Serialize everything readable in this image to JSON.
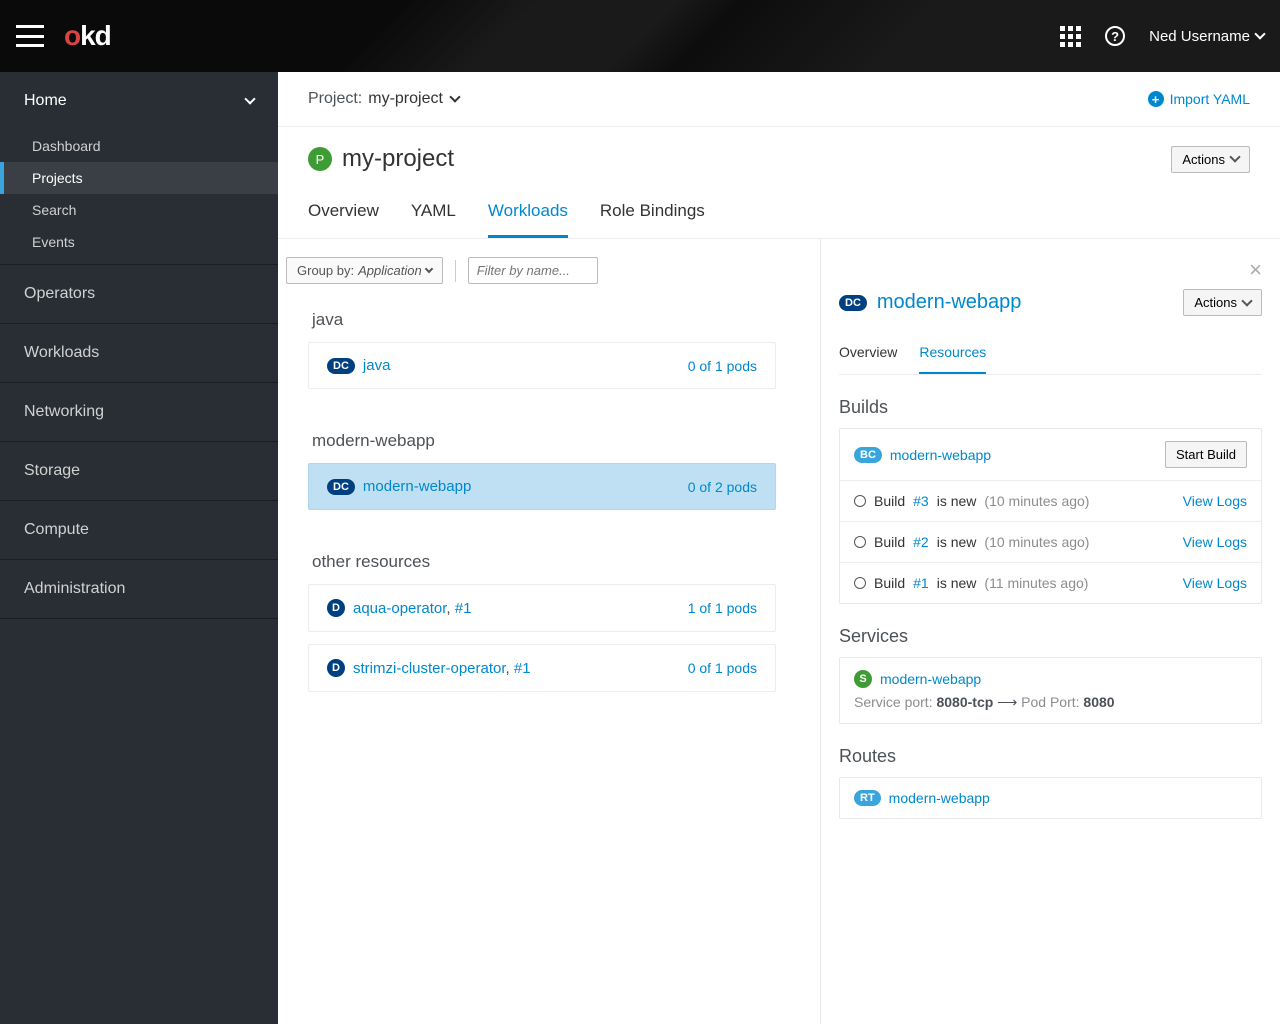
{
  "topbar": {
    "username": "Ned Username"
  },
  "sidebar": {
    "home": "Home",
    "items": [
      "Dashboard",
      "Projects",
      "Search",
      "Events"
    ],
    "sections": [
      "Operators",
      "Workloads",
      "Networking",
      "Storage",
      "Compute",
      "Administration"
    ]
  },
  "projectbar": {
    "label": "Project:",
    "name": "my-project",
    "import": "Import YAML"
  },
  "page": {
    "title": "my-project",
    "actions": "Actions"
  },
  "tabs": [
    "Overview",
    "YAML",
    "Workloads",
    "Role Bindings"
  ],
  "filters": {
    "groupby_label": "Group by:",
    "groupby_value": "Application",
    "filter_placeholder": "Filter by name..."
  },
  "groups": [
    {
      "name": "java",
      "items": [
        {
          "badge": "DC",
          "name": "java",
          "meta": "0 of 1 pods",
          "selected": false
        }
      ]
    },
    {
      "name": "modern-webapp",
      "items": [
        {
          "badge": "DC",
          "name": "modern-webapp",
          "meta": "0 of 2 pods",
          "selected": true
        }
      ]
    },
    {
      "name": "other resources",
      "items": [
        {
          "badge": "D",
          "name": "aqua-operator",
          "deploy": "#1",
          "meta": "1 of 1 pods"
        },
        {
          "badge": "D",
          "name": "strimzi-cluster-operator",
          "deploy": "#1",
          "meta": "0 of 1 pods"
        }
      ]
    }
  ],
  "detail": {
    "badge": "DC",
    "title": "modern-webapp",
    "actions": "Actions",
    "tabs": [
      "Overview",
      "Resources"
    ],
    "builds": {
      "title": "Builds",
      "bc_name": "modern-webapp",
      "start_build": "Start Build",
      "list": [
        {
          "num": "#3",
          "status": "is new",
          "time": "(10 minutes ago)",
          "view": "View Logs"
        },
        {
          "num": "#2",
          "status": "is new",
          "time": "(10 minutes ago)",
          "view": "View Logs"
        },
        {
          "num": "#1",
          "status": "is new",
          "time": "(11 minutes ago)",
          "view": "View Logs"
        }
      ],
      "build_word": "Build"
    },
    "services": {
      "title": "Services",
      "name": "modern-webapp",
      "svc_port_label": "Service port:",
      "svc_port": "8080-tcp",
      "pod_port_label": "Pod Port:",
      "pod_port": "8080"
    },
    "routes": {
      "title": "Routes",
      "name": "modern-webapp"
    }
  }
}
